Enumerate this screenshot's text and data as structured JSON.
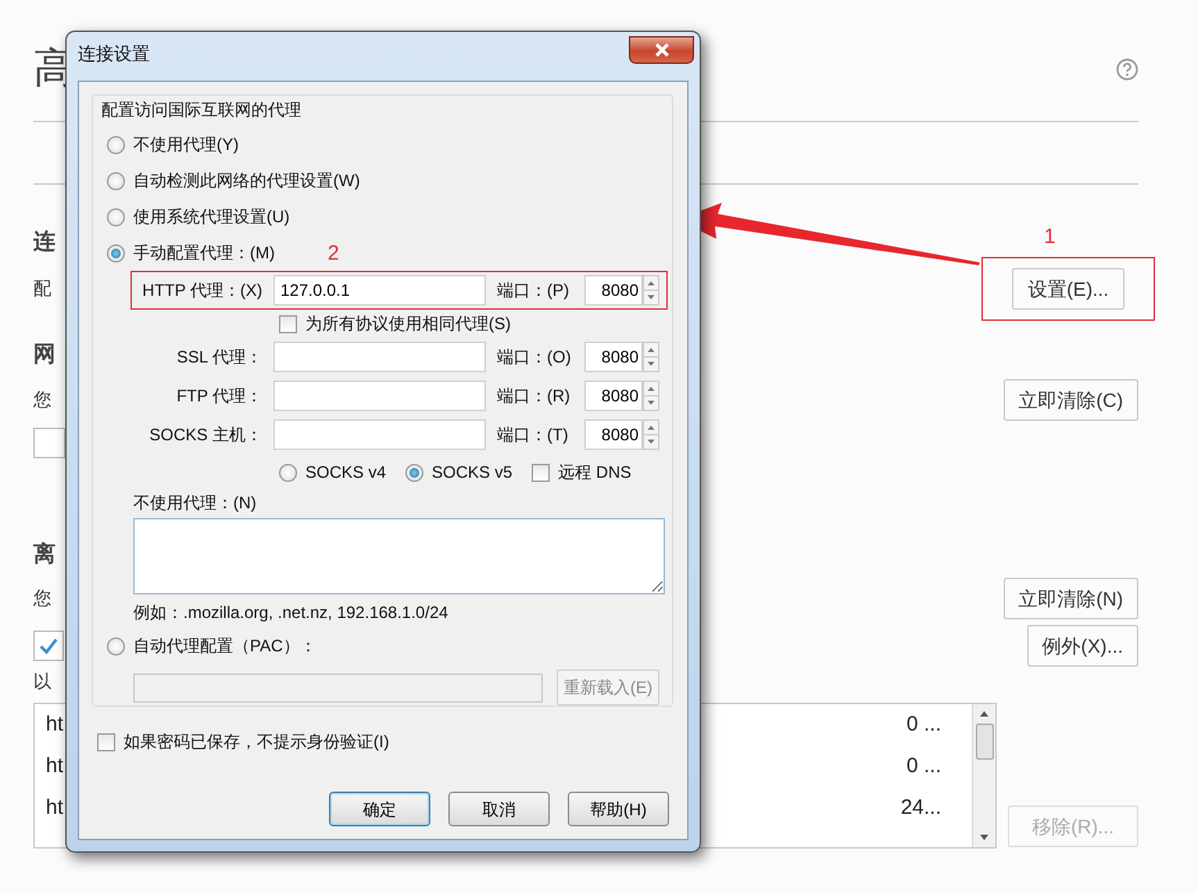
{
  "background_page": {
    "heading": "高",
    "connection": {
      "title": "连",
      "description": "配",
      "settings_button": {
        "label": "设置(E)...",
        "highlighted": true
      },
      "highlight_number": "1"
    },
    "network": {
      "title": "网",
      "description": "您",
      "clear_button": "立即清除(C)"
    },
    "offline": {
      "title": "离",
      "description": "您",
      "clear_button": "立即清除(N)",
      "checkbox_checked": true,
      "exceptions_button": "例外(X)...",
      "list_caption": "以",
      "rows": [
        {
          "column_1": "ht",
          "column_2": "0 ..."
        },
        {
          "column_1": "ht",
          "column_2": "0 ..."
        },
        {
          "column_1": "ht",
          "column_2": "24..."
        }
      ],
      "remove_button": {
        "label": "移除(R)...",
        "disabled": true
      }
    }
  },
  "annotation_arrow": true,
  "dialog": {
    "title": "连接设置",
    "group_title": "配置访问国际互联网的代理",
    "proxy_modes": [
      {
        "label": "不使用代理(Y)",
        "selected": false
      },
      {
        "label": "自动检测此网络的代理设置(W)",
        "selected": false
      },
      {
        "label": "使用系统代理设置(U)",
        "selected": false
      },
      {
        "label": "手动配置代理：(M)",
        "selected": true
      }
    ],
    "highlight_number": "2",
    "proxies": [
      {
        "label": "HTTP 代理：(X)",
        "value": "127.0.0.1",
        "port_label": "端口：(P)",
        "port": "8080",
        "highlighted": true
      },
      {
        "label": "SSL 代理：",
        "port_label": "端口：(O)",
        "port": "8080",
        "highlighted": false
      },
      {
        "label": "FTP 代理：",
        "port_label": "端口：(R)",
        "port": "8080",
        "highlighted": false
      },
      {
        "label": "SOCKS 主机：",
        "port_label": "端口：(T)",
        "port": "8080",
        "highlighted": false
      }
    ],
    "same_proxy": {
      "label": "为所有协议使用相同代理(S)",
      "checked": false
    },
    "socks_versions": [
      {
        "label": "SOCKS v4",
        "selected": false
      },
      {
        "label": "SOCKS v5",
        "selected": true
      }
    ],
    "remote_dns": {
      "label": "远程 DNS",
      "checked": false
    },
    "no_proxy_label": "不使用代理：(N)",
    "example": "例如：.mozilla.org, .net.nz, 192.168.1.0/24",
    "pac_mode": {
      "label": "自动代理配置（PAC）：",
      "selected": false
    },
    "pac_reload_button": {
      "label": "重新载入(E)",
      "disabled": true
    },
    "no_auth_prompt": {
      "label": "如果密码已保存，不提示身份验证(I)",
      "checked": false
    },
    "buttons": [
      {
        "label": "确定",
        "default": true
      },
      {
        "label": "取消",
        "default": false
      },
      {
        "label": "帮助(H)",
        "default": false
      }
    ]
  }
}
